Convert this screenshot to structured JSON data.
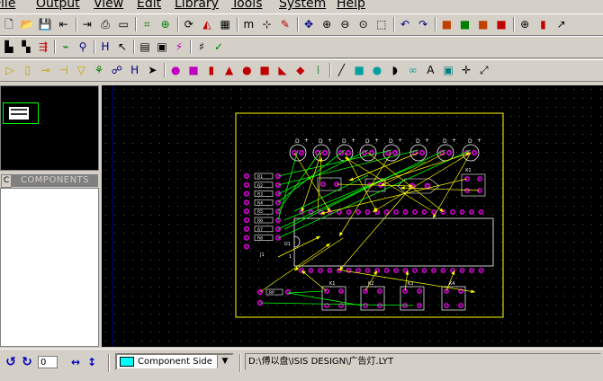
{
  "menu": [
    "File",
    "Output",
    "View",
    "Edit",
    "Library",
    "Tools",
    "System",
    "Help"
  ],
  "toolbar1": [
    "new-icon",
    "open-icon",
    "save-icon",
    "import-icon",
    "export-icon",
    "print-icon",
    "page-icon",
    "netlist-icon",
    "zoom-sheet-icon",
    "refresh-icon",
    "flip-icon",
    "grid-icon",
    "metric-icon",
    "origin-icon",
    "edit-icon",
    "pan-icon",
    "zoom-in-icon",
    "zoom-out-icon",
    "zoom-all-icon",
    "zoom-area-icon",
    "undo-icon",
    "redo-icon",
    "block-copy-icon",
    "block-move-icon",
    "block-rotate-icon",
    "block-delete-icon",
    "pick-icon",
    "make-icon",
    "decompose-icon"
  ],
  "toolbar2": [
    "library-icon",
    "packaging-icon",
    "place-icon",
    "autoroute-icon",
    "search-icon",
    "tag-icon",
    "cursor-icon",
    "design-rule-icon",
    "zone-icon",
    "power-icon",
    "ratsnest-icon",
    "check-icon"
  ],
  "toolbar3": [
    "selection-icon",
    "component-icon",
    "package-icon",
    "track-icon",
    "via-icon",
    "zone-mode-icon",
    "ratsnest-mode-icon",
    "connectivity-icon",
    "arrow-icon",
    "round-pad-icon",
    "square-pad-icon",
    "dil-pad-icon",
    "edge-pad-icon",
    "circle-pad-icon",
    "bga-pad-icon",
    "smt-pad-icon",
    "polygon-pad-icon",
    "pad-stack-icon",
    "line-icon",
    "box-icon",
    "circle-icon",
    "arc-icon",
    "path-icon",
    "text-icon",
    "symbol-icon",
    "marker-icon",
    "dimension-icon"
  ],
  "sidebar": {
    "tab_label": "C",
    "title": "COMPONENTS"
  },
  "status": {
    "rotation_value": "0",
    "layer_label": "Component Side",
    "layer_color": "#00ffff",
    "file_path": "D:\\傅以盘\\ISIS DESIGN\\广告灯.LYT"
  },
  "pcb": {
    "board_outline_color": "#ffff00",
    "pad_color": "#c000c0",
    "track_color": "#00ff00",
    "ratsnest_color": "#ffff00",
    "labels": {
      "leds": [
        "D",
        "D",
        "D",
        "D",
        "D",
        "D",
        "D",
        "D"
      ],
      "resistors": [
        "R1",
        "R2",
        "R3",
        "R4",
        "R5",
        "R6",
        "R7",
        "R8"
      ],
      "ic": "U1",
      "ic_pin": "1",
      "buttons": [
        "K1",
        "K2",
        "K3",
        "K4"
      ],
      "crystal": "X1",
      "power": "J1",
      "pack": "RP"
    }
  }
}
